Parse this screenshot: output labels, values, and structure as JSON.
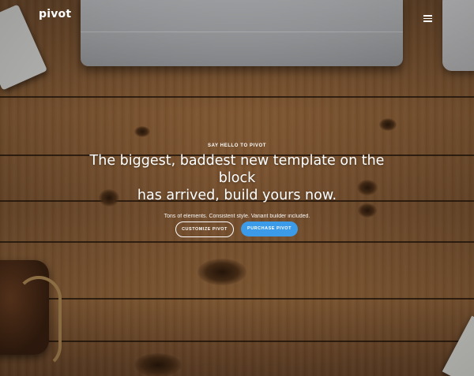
{
  "brand": {
    "logo_text": "pivot"
  },
  "nav": {
    "menu_icon": "hamburger-menu-icon"
  },
  "hero": {
    "eyebrow": "Say hello to Pivot",
    "headline_line1": "The biggest, baddest new template on the block",
    "headline_line2": "has arrived, build yours now.",
    "lede": "Tons of elements. Consistent style. Variant builder included.",
    "buttons": {
      "customize_label": "Customize Pivot",
      "purchase_label": "Purchase Pivot"
    }
  },
  "colors": {
    "accent": "#3c9be8",
    "text": "#ffffff"
  }
}
